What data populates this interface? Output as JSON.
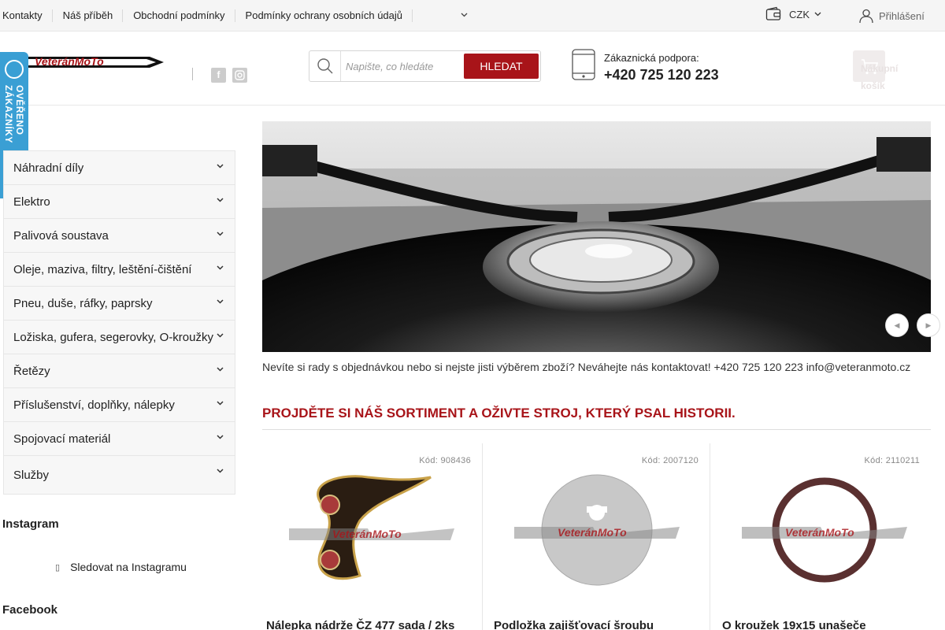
{
  "topbar": {
    "links": [
      "Kontakty",
      "Náš příběh",
      "Obchodní podmínky",
      "Podmínky ochrany osobních údajů"
    ],
    "currency": "CZK",
    "login": "Přihlášení"
  },
  "header": {
    "logo_text": "VeteránMoTo",
    "search_placeholder": "Napište, co hledáte",
    "search_button": "HLEDAT",
    "support_label": "Zákaznická podpora:",
    "support_phone": "+420 725 120 223",
    "cart_label": "Nákupní košík"
  },
  "badge": {
    "text": "OVĚŘENO ZÁKAZNÍKY"
  },
  "sidebar": {
    "categories": [
      "Náhradní díly",
      "Elektro",
      "Palivová soustava",
      "Oleje, maziva, filtry, leštění-čištění",
      "Pneu, duše, ráfky, paprsky",
      "Ložiska, gufera, segerovky, O-kroužky",
      "Řetězy",
      "Příslušenství, doplňky, nálepky",
      "Spojovací materiál",
      "Služby"
    ],
    "instagram_heading": "Instagram",
    "instagram_link": "Sledovat na Instagramu",
    "facebook_heading": "Facebook"
  },
  "main": {
    "notice": "Nevíte si rady s objednávkou nebo si nejste jisti výběrem zboží? Neváhejte nás kontaktovat! +420 725 120 223 info@veteranmoto.cz",
    "section_title": "Projděte si náš sortiment a oživte stroj, který psal historii.",
    "products": [
      {
        "code": "Kód: 908436",
        "name": "Nálepka nádrže ČZ 477 sada / 2ks"
      },
      {
        "code": "Kód: 2007120",
        "name": "Podložka zajišťovací šroubu"
      },
      {
        "code": "Kód: 2110211",
        "name": "O kroužek 19x15 unašeče"
      }
    ]
  },
  "colors": {
    "brand_red": "#a81419",
    "badge_blue": "#3a9fd4"
  }
}
